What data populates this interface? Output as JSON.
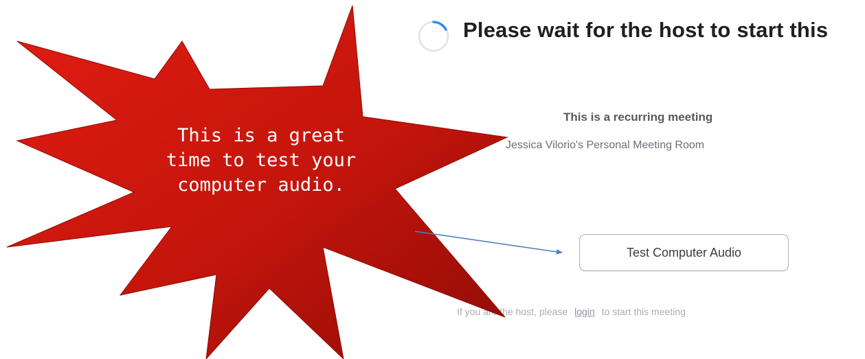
{
  "waiting_screen": {
    "heading": "Please wait for the host to start this",
    "meeting_type": "This is a recurring meeting",
    "meeting_room": "Jessica Vilorio's Personal Meeting Room",
    "test_audio_button": "Test Computer Audio",
    "footer_prefix": "If you are the host, please",
    "footer_link": "login",
    "footer_suffix": "to start this meeting",
    "spinner_icon": "loading-spinner-icon"
  },
  "annotation": {
    "callout_text": "This is a great\ntime to test your\ncomputer audio.",
    "callout_color": "#c4150c",
    "arrow_color": "#4f81bd"
  }
}
